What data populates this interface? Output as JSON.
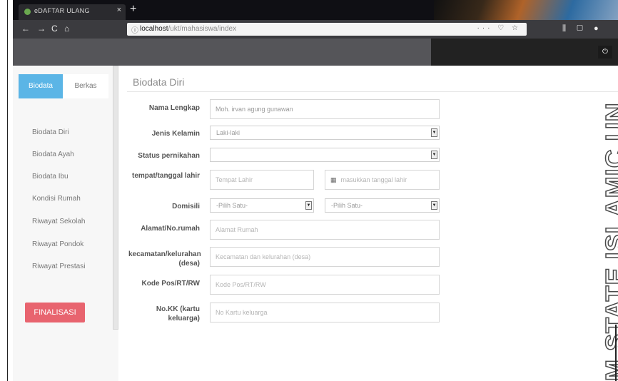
{
  "browser": {
    "tab_title": "eDAFTAR ULANG",
    "tab_close": "×",
    "new_tab": "+",
    "nav": {
      "back": "←",
      "forward": "→",
      "reload": "C",
      "home": "⌂"
    },
    "url_info": "ⓘ",
    "url_host": "localhost",
    "url_path": "/ukt/mahasiswa/index",
    "url_tools": "··· ♡ ☆",
    "right_tools": "⫼ ▢ ●"
  },
  "header": {
    "power_icon": "⏻"
  },
  "sidebar": {
    "tabs": [
      {
        "label": "Biodata"
      },
      {
        "label": "Berkas"
      }
    ],
    "items": [
      {
        "label": "Biodata Diri"
      },
      {
        "label": "Biodata Ayah"
      },
      {
        "label": "Biodata Ibu"
      },
      {
        "label": "Kondisi Rumah"
      },
      {
        "label": "Riwayat Sekolah"
      },
      {
        "label": "Riwayat Pondok"
      },
      {
        "label": "Riwayat Prestasi"
      }
    ],
    "finalisasi_label": "FINALISASI"
  },
  "main": {
    "title": "Biodata Diri",
    "fields": {
      "nama": {
        "label": "Nama Lengkap",
        "value": "Moh. irvan agung gunawan"
      },
      "jenis_kelamin": {
        "label": "Jenis Kelamin",
        "value": "Laki-laki"
      },
      "status": {
        "label": "Status pernikahan",
        "value": ""
      },
      "ttl": {
        "label": "tempat/tanggal lahir",
        "tempat_placeholder": "Tempat Lahir",
        "tanggal_placeholder": "masukkan tanggal lahir"
      },
      "domisili": {
        "label": "Domisili",
        "option1": "-Pilih Satu-",
        "option2": "-Pilih Satu-"
      },
      "alamat": {
        "label": "Alamat/No.rumah",
        "placeholder": "Alamat Rumah"
      },
      "kecamatan": {
        "label": "kecamatan/kelurahan (desa)",
        "placeholder": "Kecamatan dan kelurahan (desa)"
      },
      "kodepos": {
        "label": "Kode Pos/RT/RW",
        "placeholder": "Kode Pos/RT/RW"
      },
      "nokk": {
        "label": "No.KK (kartu keluarga)",
        "placeholder": "No Kartu keluarga"
      }
    }
  },
  "watermark": "M STATE ISLAMIC UN"
}
